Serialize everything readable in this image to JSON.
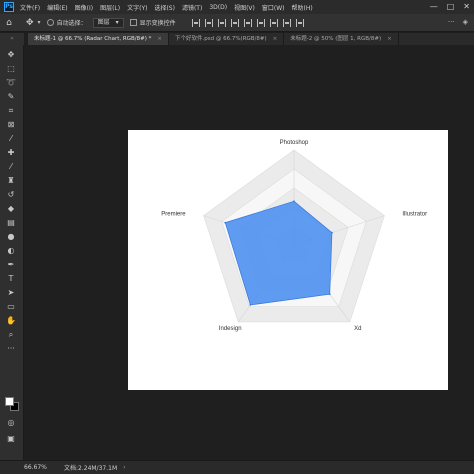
{
  "menubar": {
    "logo": "Ps",
    "items": [
      "文件(F)",
      "编辑(E)",
      "图像(I)",
      "图层(L)",
      "文字(Y)",
      "选择(S)",
      "滤镜(T)",
      "3D(D)",
      "视图(V)",
      "窗口(W)",
      "帮助(H)"
    ],
    "controls": [
      "—",
      "□",
      "✕"
    ]
  },
  "options": {
    "auto_select_label": "自动选择：",
    "layer_select": "图层",
    "show_transform_label": "显示变换控件"
  },
  "tabs": [
    {
      "label": "未标题-1 @ 66.7% (Radar Chart, RGB/8#) *",
      "close": "×"
    },
    {
      "label": "下个好软件.psd @ 66.7%(RGB/8#)",
      "close": "×"
    },
    {
      "label": "未标题-2 @ 50% (图层 1, RGB/8#)",
      "close": "×"
    }
  ],
  "chart_data": {
    "type": "radar",
    "axes": [
      "Photoshop",
      "Illustrator",
      "Xd",
      "Indesign",
      "Premiere"
    ],
    "levels": 5,
    "max": 5,
    "series": [
      {
        "values": [
          2.3,
          2.1,
          3.2,
          3.9,
          3.8
        ],
        "color": "#4a90f0"
      }
    ]
  },
  "status": {
    "zoom": "66.67%",
    "doc": "文档:2.24M/37.1M"
  },
  "colors": {
    "fill": "#4a8ff0",
    "grid_band_a": "#ebebeb",
    "grid_band_b": "#f7f7f7"
  }
}
